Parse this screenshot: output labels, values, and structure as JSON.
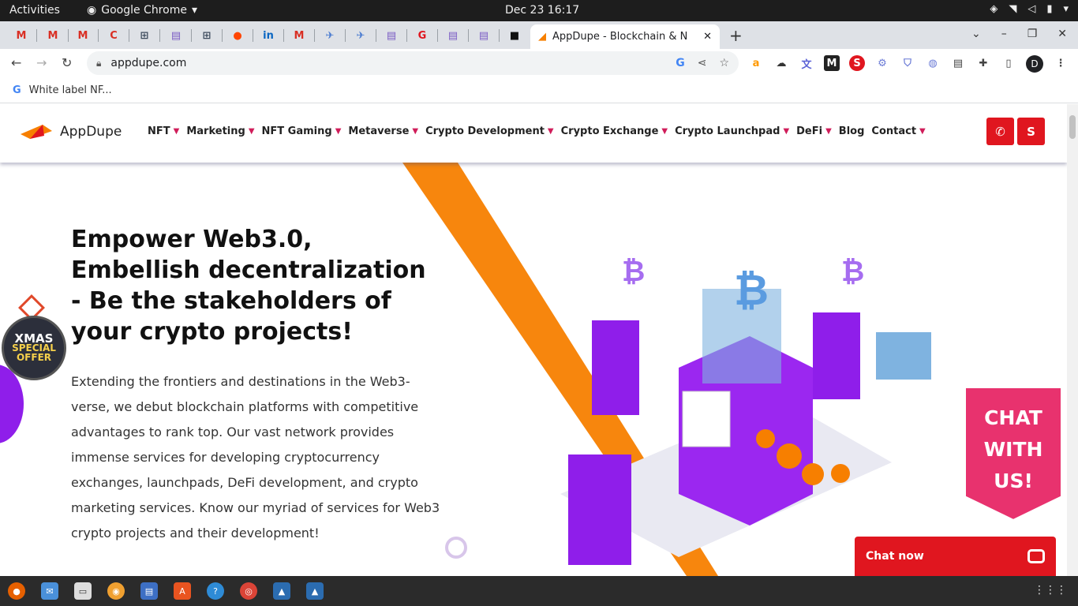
{
  "system": {
    "activities": "Activities",
    "app_name": "Google Chrome",
    "clock": "Dec 23  16:17"
  },
  "browser": {
    "active_tab_title": "AppDupe - Blockchain & N",
    "url": "appdupe.com",
    "bookmark": "White label NF...",
    "profile_initial": "D"
  },
  "site": {
    "logo_text": "AppDupe",
    "nav": [
      {
        "label": "NFT",
        "dropdown": true
      },
      {
        "label": "Marketing",
        "dropdown": true
      },
      {
        "label": "NFT Gaming",
        "dropdown": true
      },
      {
        "label": "Metaverse",
        "dropdown": true
      },
      {
        "label": "Crypto Development",
        "dropdown": true
      },
      {
        "label": "Crypto Exchange",
        "dropdown": true
      },
      {
        "label": "Crypto Launchpad",
        "dropdown": true
      },
      {
        "label": "DeFi",
        "dropdown": true
      },
      {
        "label": "Blog",
        "dropdown": false
      },
      {
        "label": "Contact",
        "dropdown": true
      }
    ],
    "hero_title": "Empower Web3.0, Embellish decentralization - Be the stakeholders of your crypto projects!",
    "hero_text": "Extending the frontiers and destinations in the Web3-verse, we debut blockchain platforms with competitive advantages to rank top. Our vast network provides immense services for developing cryptocurrency exchanges, launchpads, DeFi development, and crypto marketing services. Know our myriad of services for Web3 crypto projects and their development!",
    "xmas": {
      "line1": "XMAS",
      "line2": "SPECIAL",
      "line3": "OFFER"
    },
    "chat_badge": {
      "line1": "CHAT",
      "line2": "WITH",
      "line3": "US!"
    },
    "chat_now": "Chat now"
  },
  "colors": {
    "brand_red": "#e0161f",
    "accent_pink": "#d01d5a",
    "purple": "#8f1eea",
    "orange": "#f77f00"
  }
}
